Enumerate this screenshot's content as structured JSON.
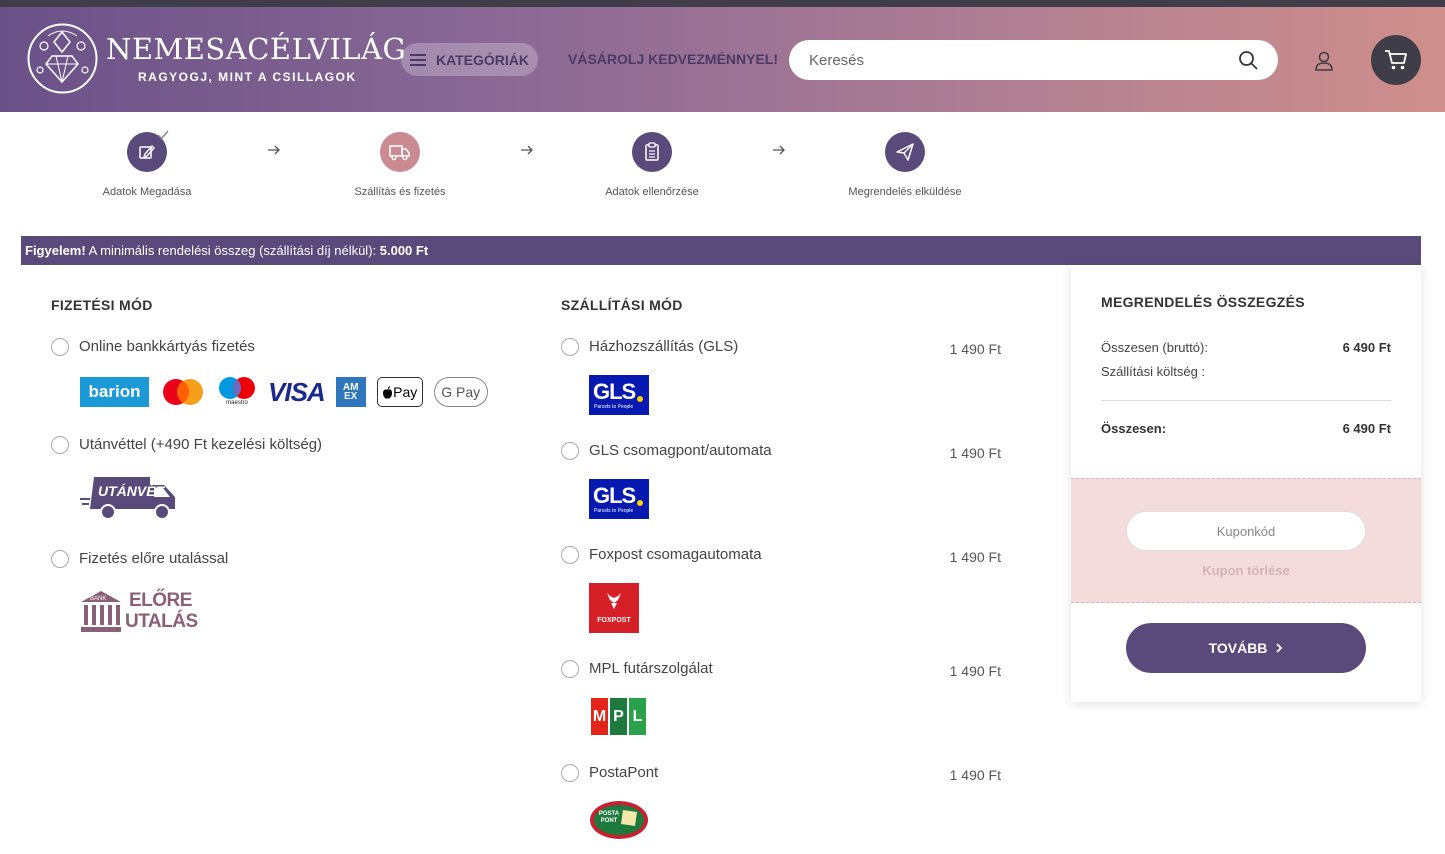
{
  "brand": {
    "name": "NEMESACÉLVILÁG",
    "tagline": "RAGYOGJ, MINT A CSILLAGOK"
  },
  "header": {
    "categories_label": "KATEGÓRIÁK",
    "promo_label": "VÁSÁROLJ KEDVEZMÉNNYEL!",
    "search_placeholder": "Keresés"
  },
  "steps": [
    {
      "label": "Adatok Megadása",
      "color": "#5a4a7c",
      "icon": "edit-check-icon"
    },
    {
      "label": "Szállítás és fizetés",
      "color": "#c98a91",
      "icon": "truck-icon"
    },
    {
      "label": "Adatok ellenőrzése",
      "color": "#5a4a7c",
      "icon": "clipboard-icon"
    },
    {
      "label": "Megrendelés elküldése",
      "color": "#5a4a7c",
      "icon": "paper-plane-icon"
    }
  ],
  "notice": {
    "strong": "Figyelem!",
    "text": " A minimális rendelési összeg (szállítási díj nélkül): ",
    "amount": "5.000 Ft"
  },
  "payment": {
    "title": "FIZETÉSI MÓD",
    "options": [
      {
        "label": "Online bankkártyás fizetés"
      },
      {
        "label": "Utánvéttel (+490 Ft kezelési költség)",
        "badge": "UTÁNVÉT"
      },
      {
        "label": "Fizetés előre utalással",
        "badge_line1": "ELŐRE",
        "badge_line2": "UTALÁS",
        "bank": "BANK"
      }
    ],
    "card_logos": {
      "barion": "barion",
      "maestro": "maestro",
      "visa": "VISA",
      "amex": "AM EX",
      "applepay": "Pay",
      "gpay": "G Pay"
    }
  },
  "shipping": {
    "title": "SZÁLLÍTÁSI MÓD",
    "options": [
      {
        "label": "Házhozszállítás (GLS)",
        "price": "1 490 Ft"
      },
      {
        "label": "GLS csomagpont/automata",
        "price": "1 490 Ft"
      },
      {
        "label": "Foxpost csomagautomata",
        "price": "1 490 Ft"
      },
      {
        "label": "MPL futárszolgálat",
        "price": "1 490 Ft"
      },
      {
        "label": "PostaPont",
        "price": "1 490 Ft"
      }
    ],
    "gls_logo": "GLS",
    "gls_sub": "Parcels to People",
    "foxpost_logo": "FOXPOST",
    "mpl_letters": [
      "M",
      "P",
      "L"
    ],
    "postapont_logo": "POSTA PONT"
  },
  "summary": {
    "title": "MEGRENDELÉS ÖSSZEGZÉS",
    "gross_label": "Összesen (bruttó):",
    "gross_value": "6 490 Ft",
    "shipping_label": "Szállítási költség :",
    "total_label": "Összesen:",
    "total_value": "6 490 Ft",
    "coupon_placeholder": "Kuponkód",
    "coupon_remove": "Kupon törlése",
    "next_label": "TOVÁBB"
  },
  "colors": {
    "primary": "#5a4a7c",
    "accent": "#c98a91",
    "dark": "#3f3d48"
  }
}
